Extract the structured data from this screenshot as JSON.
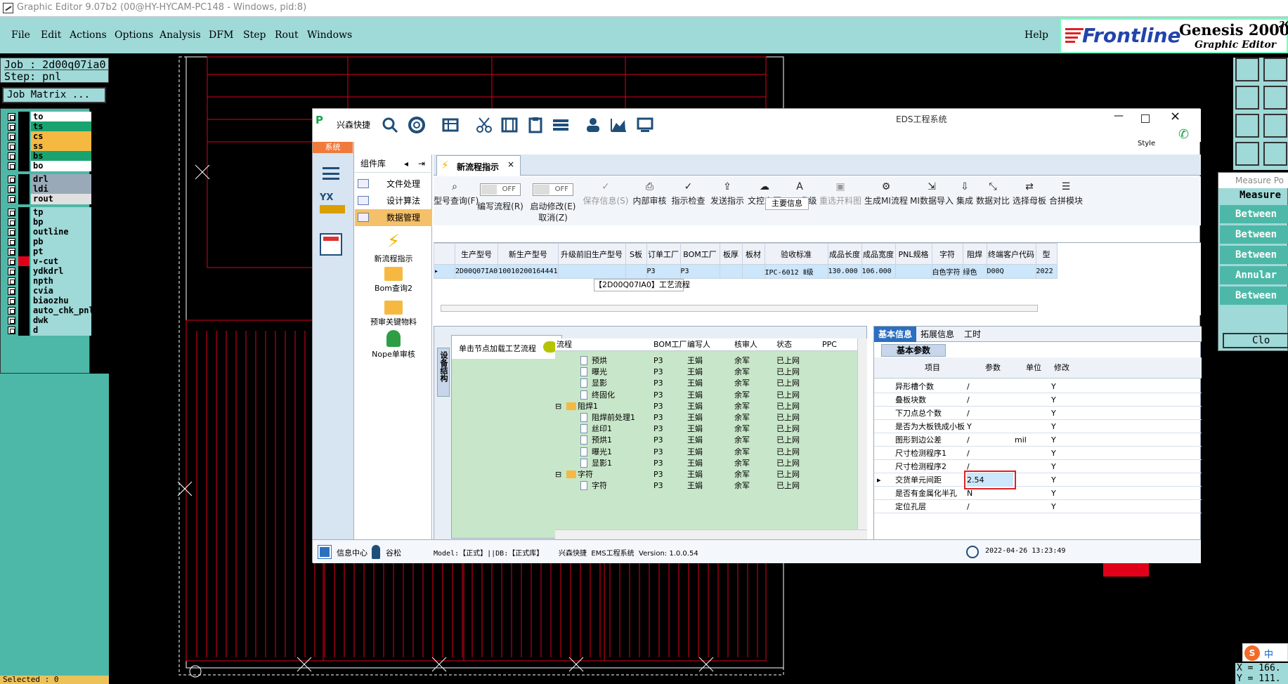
{
  "window": {
    "title": "Graphic Editor 9.07b2 (00@HY-HYCAM-PC148 - Windows, pid:8)"
  },
  "menu": {
    "items": [
      "File",
      "Edit",
      "Actions",
      "Options",
      "Analysis",
      "DFM",
      "Step",
      "Rout",
      "Windows"
    ],
    "help": "Help"
  },
  "brand": {
    "logo": "Frontline",
    "product": "Genesis 2000",
    "version_sup": "2G",
    "subtitle": "Graphic Editor"
  },
  "job": {
    "job_label": "Job : 2d00q07ia0",
    "step_label": "Step: pnl",
    "matrix_button": "Job Matrix ..."
  },
  "layers": [
    {
      "name": "to",
      "color": "#ffffff"
    },
    {
      "name": "ts",
      "color": "#1aa36f"
    },
    {
      "name": "cs",
      "color": "#f5b942"
    },
    {
      "name": "ss",
      "color": "#f5b942"
    },
    {
      "name": "bs",
      "color": "#1aa36f"
    },
    {
      "name": "bo",
      "color": "#ffffff"
    },
    {
      "name": "drl",
      "color": "#9aa9b8"
    },
    {
      "name": "ldi",
      "color": "#9aa9b8"
    },
    {
      "name": "rout",
      "color": "#e0e0e0"
    },
    {
      "name": "tp",
      "color": "#9fd9d8"
    },
    {
      "name": "bp",
      "color": "#9fd9d8"
    },
    {
      "name": "outline",
      "color": "#9fd9d8"
    },
    {
      "name": "pb",
      "color": "#9fd9d8"
    },
    {
      "name": "pt",
      "color": "#9fd9d8"
    },
    {
      "name": "v-cut",
      "color": "#9fd9d8"
    },
    {
      "name": "ydkdrl",
      "color": "#9fd9d8"
    },
    {
      "name": "npth",
      "color": "#9fd9d8"
    },
    {
      "name": "cvia",
      "color": "#9fd9d8"
    },
    {
      "name": "biaozhu",
      "color": "#9fd9d8"
    },
    {
      "name": "auto_chk_pnl",
      "color": "#9fd9d8"
    },
    {
      "name": "dwk",
      "color": "#9fd9d8"
    },
    {
      "name": "d",
      "color": "#9fd9d8"
    }
  ],
  "selected": "Selected : 0",
  "measure": {
    "title": "Measure Po",
    "header": "Measure",
    "rows": [
      "Between",
      "Between",
      "Between",
      "Annular",
      "Between"
    ],
    "close": "Clo"
  },
  "coords": {
    "x": "X = 166.",
    "y": "Y = 111."
  },
  "ime": {
    "label": "中"
  },
  "eds": {
    "app_title": "EDS工程系统",
    "company": "兴森快捷",
    "style_label": "Style",
    "sys_tab": "系统",
    "component_lib": "组件库",
    "nav": [
      "文件处理",
      "设计算法",
      "数据管理"
    ],
    "big_items": [
      "新流程指示",
      "Bom查询2",
      "预审关键物料",
      "Nope单审核"
    ],
    "tab_title": "新流程指示",
    "toolbar": [
      {
        "icon": "search-icon",
        "label": "型号查询(F)"
      },
      {
        "icon": "toggle",
        "label": "编写流程(R)"
      },
      {
        "icon": "toggle",
        "label": "启动修改(E)"
      },
      {
        "icon": "check-icon",
        "label": "保存信息(S)"
      },
      {
        "icon": "print-icon",
        "label": "内部审核"
      },
      {
        "icon": "check-icon",
        "label": "指示检查"
      },
      {
        "icon": "upload-icon",
        "label": "发送指示"
      },
      {
        "icon": "cloud-icon",
        "label": "文控上网"
      },
      {
        "icon": "ecn-icon",
        "label": "ECN升级"
      },
      {
        "icon": "image-icon",
        "label": "重选开料图"
      },
      {
        "icon": "flow-icon",
        "label": "生成MI流程"
      },
      {
        "icon": "import-icon",
        "label": "MI数据导入"
      },
      {
        "icon": "download-icon",
        "label": "集成"
      },
      {
        "icon": "compare-icon",
        "label": "数据对比"
      },
      {
        "icon": "shuffle-icon",
        "label": "选择母板"
      },
      {
        "icon": "list-icon",
        "label": "合拼模块"
      }
    ],
    "toggle_off": "OFF",
    "cancel_label": "取消(Z)",
    "main_info_label": "主要信息",
    "main_table": {
      "headers": [
        "生产型号",
        "新生产型号",
        "升级前旧生产型号",
        "S板",
        "订单工厂",
        "BOM工厂",
        "板厚",
        "板材",
        "验收标准",
        "成品长度",
        "成品宽度",
        "PNL规格",
        "字符",
        "阻焊",
        "终端客户代码",
        "型"
      ],
      "row": [
        "2D00Q07IA0",
        "10010200164441",
        "",
        "",
        "P3",
        "P3",
        "",
        "",
        "IPC-6012 Ⅱ级",
        "130.000",
        "106.000",
        "",
        "白色字符",
        "绿色",
        "D00Q",
        "2022"
      ]
    },
    "flow_title": "【2D00Q07IA0】工艺流程",
    "side_tab": "设备结构",
    "click_hint": "单击节点加载工艺流程",
    "tree_headers": [
      "流程",
      "BOM工厂",
      "编写人",
      "核审人",
      "状态",
      "PPC"
    ],
    "tree_rows": [
      {
        "indent": 1,
        "type": "doc",
        "name": "预烘",
        "bom": "P3",
        "writer": "王娟",
        "checker": "余军",
        "status": "已上网"
      },
      {
        "indent": 1,
        "type": "doc",
        "name": "曝光",
        "bom": "P3",
        "writer": "王娟",
        "checker": "余军",
        "status": "已上网"
      },
      {
        "indent": 1,
        "type": "doc",
        "name": "显影",
        "bom": "P3",
        "writer": "王娟",
        "checker": "余军",
        "status": "已上网"
      },
      {
        "indent": 1,
        "type": "doc",
        "name": "终固化",
        "bom": "P3",
        "writer": "王娟",
        "checker": "余军",
        "status": "已上网"
      },
      {
        "indent": 0,
        "type": "folder",
        "name": "阻焊1",
        "bom": "P3",
        "writer": "王娟",
        "checker": "余军",
        "status": "已上网"
      },
      {
        "indent": 1,
        "type": "doc",
        "name": "阻焊前处理1",
        "bom": "P3",
        "writer": "王娟",
        "checker": "余军",
        "status": "已上网"
      },
      {
        "indent": 1,
        "type": "doc",
        "name": "丝印1",
        "bom": "P3",
        "writer": "王娟",
        "checker": "余军",
        "status": "已上网"
      },
      {
        "indent": 1,
        "type": "doc",
        "name": "预烘1",
        "bom": "P3",
        "writer": "王娟",
        "checker": "余军",
        "status": "已上网"
      },
      {
        "indent": 1,
        "type": "doc",
        "name": "曝光1",
        "bom": "P3",
        "writer": "王娟",
        "checker": "余军",
        "status": "已上网"
      },
      {
        "indent": 1,
        "type": "doc",
        "name": "显影1",
        "bom": "P3",
        "writer": "王娟",
        "checker": "余军",
        "status": "已上网"
      },
      {
        "indent": 0,
        "type": "folder",
        "name": "字符",
        "bom": "P3",
        "writer": "王娟",
        "checker": "余军",
        "status": "已上网"
      },
      {
        "indent": 1,
        "type": "doc",
        "name": "字符",
        "bom": "P3",
        "writer": "王娟",
        "checker": "余军",
        "status": "已上网"
      }
    ],
    "props_tabs": [
      "基本信息",
      "拓展信息",
      "工时"
    ],
    "props_subtab": "基本参数",
    "props_headers": [
      "项目",
      "参数",
      "单位",
      "修改"
    ],
    "props_rows": [
      {
        "item": "异形槽个数",
        "param": "/",
        "unit": "",
        "edit": "Y"
      },
      {
        "item": "叠板块数",
        "param": "/",
        "unit": "",
        "edit": "Y"
      },
      {
        "item": "下刀点总个数",
        "param": "/",
        "unit": "",
        "edit": "Y"
      },
      {
        "item": "是否为大板铣成小板",
        "param": "Y",
        "unit": "",
        "edit": "Y"
      },
      {
        "item": "图形到边公差",
        "param": "/",
        "unit": "mil",
        "edit": "Y"
      },
      {
        "item": "尺寸检测程序1",
        "param": "/",
        "unit": "",
        "edit": "Y"
      },
      {
        "item": "尺寸检测程序2",
        "param": "/",
        "unit": "",
        "edit": "Y"
      },
      {
        "item": "交货单元间距",
        "param": "2.54",
        "unit": "",
        "edit": "Y"
      },
      {
        "item": "是否有金属化半孔",
        "param": "N",
        "unit": "",
        "edit": "Y"
      },
      {
        "item": "定位孔层",
        "param": "/",
        "unit": "",
        "edit": "Y"
      }
    ],
    "status": {
      "info_center": "信息中心",
      "user": "谷松",
      "model": "Model:【正式】||DB:【正式库】",
      "system": "兴森快捷  EMS工程系统  Version: 1.0.0.54",
      "datetime": "2022-04-26 13:23:49"
    }
  }
}
